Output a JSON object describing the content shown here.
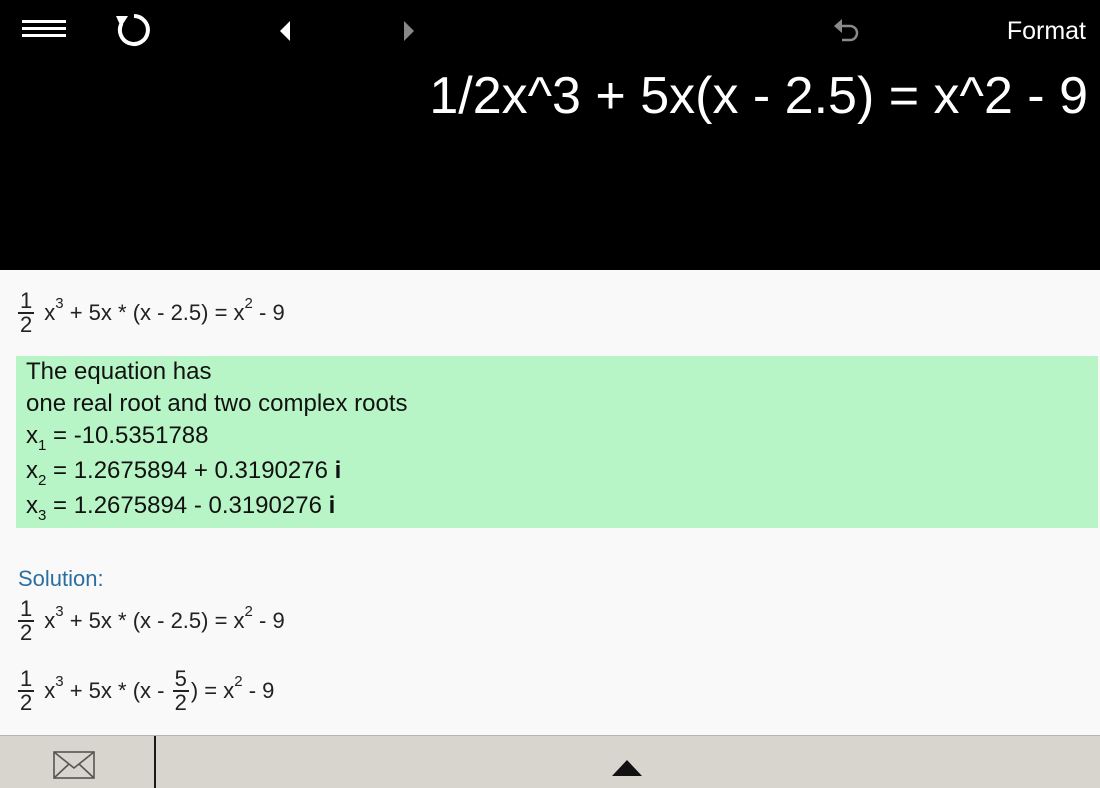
{
  "toolbar": {
    "menu_icon": "menu-icon",
    "reload_icon": "reload-icon",
    "back_icon": "left-arrow-icon",
    "forward_icon": "right-arrow-icon",
    "undo_icon": "undo-icon",
    "format_label": "Format"
  },
  "input": {
    "expression": "1/2x^3 + 5x(x - 2.5) = x^2 - 9"
  },
  "equation_line": {
    "frac_num": "1",
    "frac_den": "2",
    "x": "x",
    "exp3": "3",
    "middle": " + 5x * (x - 2.5) = x",
    "exp2": "2",
    "tail": " - 9"
  },
  "result": {
    "line1": "The equation has",
    "line2": "one real root and two complex roots",
    "roots": [
      {
        "var": "x",
        "sub": "1",
        "value": " = -10.5351788",
        "imag": ""
      },
      {
        "var": "x",
        "sub": "2",
        "value": " = 1.2675894 + 0.3190276 ",
        "imag": "i"
      },
      {
        "var": "x",
        "sub": "3",
        "value": " = 1.2675894 - 0.3190276 ",
        "imag": "i"
      }
    ],
    "background": "#b8f5c6"
  },
  "solution": {
    "label": "Solution:",
    "step1": {
      "frac_num": "1",
      "frac_den": "2",
      "x": "x",
      "exp3": "3",
      "middle": " + 5x * (x - 2.5) = x",
      "exp2": "2",
      "tail": " - 9"
    },
    "step2": {
      "frac_num": "1",
      "frac_den": "2",
      "x": "x",
      "exp3": "3",
      "middle_a": " + 5x * (x - ",
      "frac2_num": "5",
      "frac2_den": "2",
      "middle_b": ") = x",
      "exp2": "2",
      "tail": " - 9"
    }
  },
  "footer": {
    "mail_icon": "mail-icon",
    "expand_icon": "expand-up-icon"
  },
  "colors": {
    "header_bg": "#000000",
    "result_bg": "#b8f5c6",
    "solution_label": "#2a6fa0",
    "footer_bg": "#d8d5cf"
  }
}
